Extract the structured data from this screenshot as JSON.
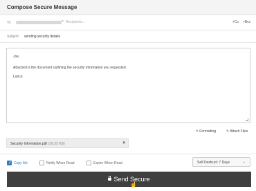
{
  "dialog": {
    "title": "Compose Secure Message"
  },
  "to": {
    "label": "To:",
    "chip_remove": "×",
    "placeholder": "Recipients...",
    "cc": "+Cc",
    "bcc": "+Bcc"
  },
  "subject": {
    "label": "Subject:",
    "value": "sending security details"
  },
  "body": {
    "lines": [
      "Joe,",
      "Attached is the document outlining the security information you requested.",
      "Lance"
    ]
  },
  "toolbar": {
    "formatting_label": "Formatting",
    "attach_label": "Attach Files"
  },
  "attachment": {
    "filename": "Security Information.pdf",
    "size": "(58.35 KB)",
    "remove": "×"
  },
  "options": {
    "copy_me": {
      "label": "Copy Me",
      "checked": true
    },
    "notify": {
      "label": "Notify When Read",
      "checked": false
    },
    "expire": {
      "label": "Expire When Read",
      "checked": false
    }
  },
  "self_destruct": {
    "value": "Self Destruct: 7 Days"
  },
  "send_button": {
    "label": "Send Secure"
  },
  "colors": {
    "accent": "#2f7bbf",
    "send_bg": "#3f3f3f"
  }
}
